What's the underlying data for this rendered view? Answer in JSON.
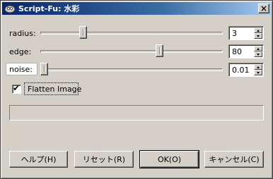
{
  "window": {
    "title": "Script-Fu: 水彩",
    "icon": "gimp-wilber-icon",
    "close_label": "×"
  },
  "params": [
    {
      "label": "radius:",
      "value": "3",
      "slider_fraction": 0.23
    },
    {
      "label": "edge:",
      "value": "80",
      "slider_fraction": 0.63
    },
    {
      "label": "noise:",
      "value": "0.01",
      "slider_fraction": 0.0
    }
  ],
  "flatten": {
    "label": "Flatten Image",
    "checked": true,
    "check_mark": "✔"
  },
  "progress": {
    "value": 0
  },
  "buttons": {
    "help": "ヘルプ(H)",
    "reset": "リセット(R)",
    "ok": "OK(O)",
    "cancel": "キャンセル(C)"
  }
}
